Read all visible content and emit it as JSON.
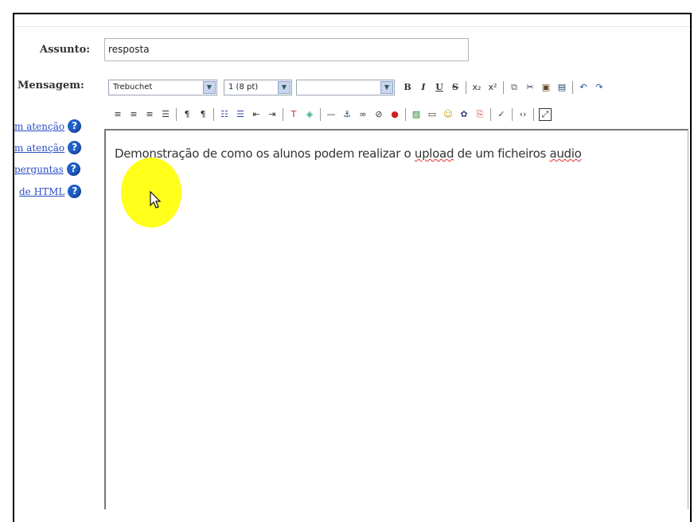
{
  "form": {
    "subject_label": "Assunto:",
    "subject_value": "resposta",
    "message_label": "Mensagem:"
  },
  "help_links": [
    {
      "label": "m atenção"
    },
    {
      "label": "m atenção"
    },
    {
      "label": "perguntas"
    },
    {
      "label": "de HTML"
    }
  ],
  "toolbar": {
    "font_family": "Trebuchet",
    "font_size": "1 (8 pt)",
    "style_value": "",
    "bold": "B",
    "italic": "I",
    "underline": "U",
    "strike": "S",
    "subscript": "x₂",
    "superscript": "x²"
  },
  "editor": {
    "text_before": "Demonstração de como os alunos podem realizar o ",
    "text_spell1": "upload",
    "text_middle": " de um ficheiros ",
    "text_spell2": "audio"
  },
  "colors": {
    "link": "#2b4dc8",
    "help_icon": "#1f5fc9",
    "highlight": "#ffff1a"
  }
}
